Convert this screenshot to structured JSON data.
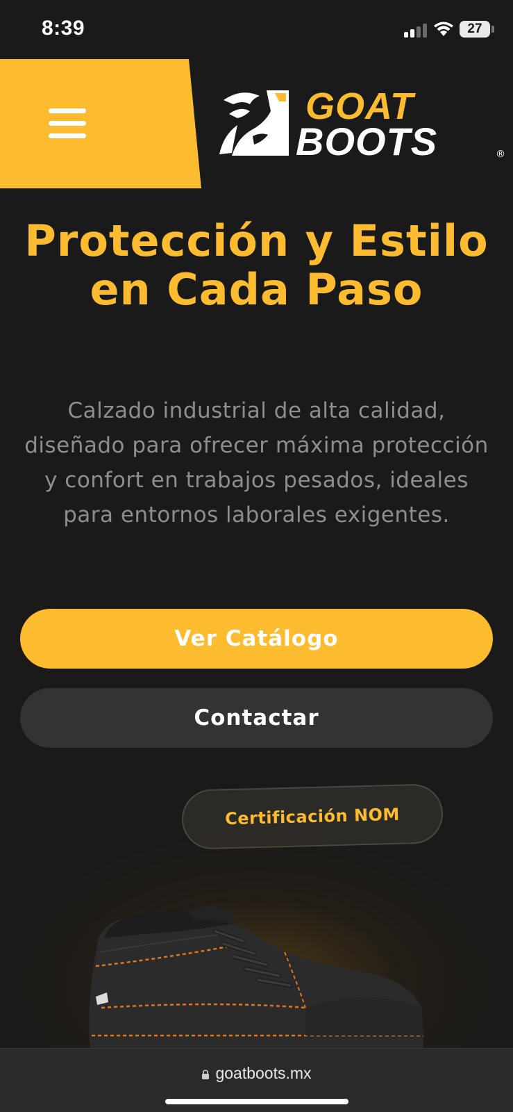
{
  "status_bar": {
    "time": "8:39",
    "battery": "27",
    "icons": [
      "signal-icon",
      "wifi-icon",
      "battery-icon"
    ]
  },
  "header": {
    "menu_icon": "hamburger-menu-icon",
    "logo": {
      "line1": "GOAT",
      "line2": "BOOTS",
      "registered": "®"
    }
  },
  "hero": {
    "title": "Protección y Estilo en Cada Paso",
    "description": "Calzado industrial de alta calidad, diseñado para ofrecer máxima protección y confort en trabajos pesados, ideales para entornos laborales exigentes.",
    "catalog_button": "Ver Catálogo",
    "contact_button": "Contactar",
    "badge": "Certificación NOM"
  },
  "browser": {
    "url": "goatboots.mx"
  },
  "colors": {
    "accent": "#fdbb30",
    "background": "#1a1a1a",
    "secondary_button": "#333333",
    "muted_text": "#8e8e8e"
  }
}
